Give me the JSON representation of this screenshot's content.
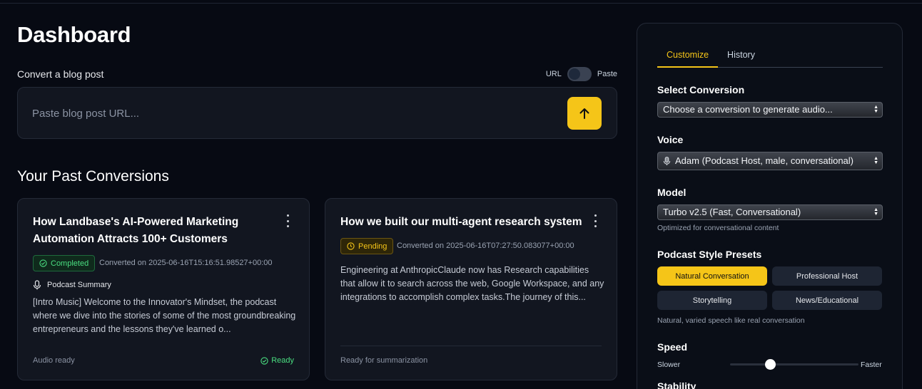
{
  "page": {
    "title": "Dashboard"
  },
  "convert": {
    "label": "Convert a blog post",
    "toggle_left": "URL",
    "toggle_right": "Paste",
    "placeholder": "Paste blog post URL..."
  },
  "past": {
    "title": "Your Past Conversions",
    "cards": [
      {
        "title": "How Landbase's AI-Powered Marketing Automation Attracts 100+ Customers",
        "status": "Completed",
        "converted": "Converted on 2025-06-16T15:16:51.98527+00:00",
        "summary_label": "Podcast Summary",
        "summary": "[Intro Music] Welcome to the Innovator's Mindset, the podcast where we dive into the stories of some of the most groundbreaking entrepreneurs and the lessons they've learned o...",
        "footer_left": "Audio ready",
        "footer_right": "Ready"
      },
      {
        "title": "How we built our multi-agent research system",
        "status": "Pending",
        "converted": "Converted on 2025-06-16T07:27:50.083077+00:00",
        "excerpt": "Engineering at AnthropicClaude now has Research capabilities that allow it to search across the web, Google Workspace, and any integrations to accomplish complex tasks.The journey of this...",
        "footer_left": "Ready for summarization"
      }
    ]
  },
  "sidebar": {
    "tabs": [
      "Customize",
      "History"
    ],
    "select_conversion": {
      "label": "Select Conversion",
      "value": "Choose a conversion to generate audio..."
    },
    "voice": {
      "label": "Voice",
      "value": "Adam (Podcast Host, male, conversational)"
    },
    "model": {
      "label": "Model",
      "value": "Turbo v2.5 (Fast, Conversational)",
      "hint": "Optimized for conversational content"
    },
    "presets": {
      "label": "Podcast Style Presets",
      "items": [
        "Natural Conversation",
        "Professional Host",
        "Storytelling",
        "News/Educational"
      ],
      "hint": "Natural, varied speech like real conversation"
    },
    "speed": {
      "label": "Speed",
      "min_label": "Slower",
      "max_label": "Faster",
      "value": 0.4
    },
    "stability": {
      "label": "Stability"
    }
  },
  "colors": {
    "accent": "#f5c518",
    "success": "#4ade80",
    "background": "#070a13"
  }
}
